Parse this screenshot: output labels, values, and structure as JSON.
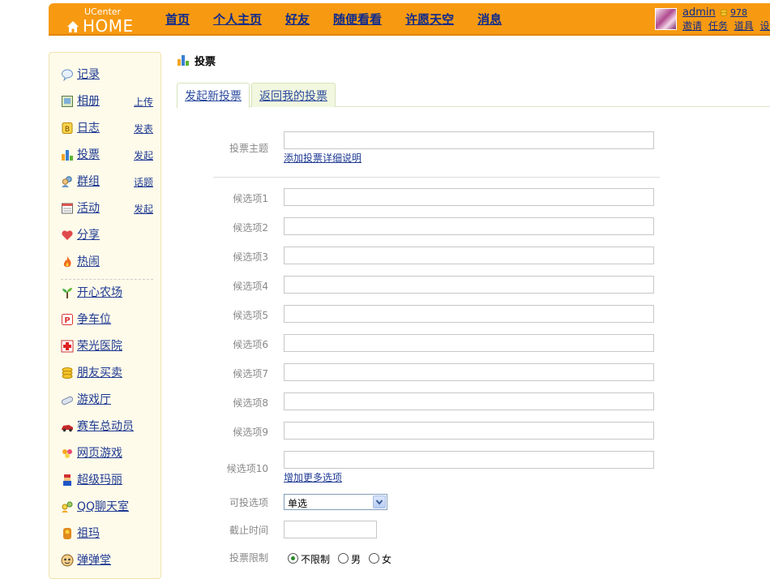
{
  "header": {
    "logo_top": "UCenter",
    "logo_main": "HOME",
    "nav": [
      "首页",
      "个人主页",
      "好友",
      "随便看看",
      "许愿天空",
      "消息"
    ],
    "user": {
      "name": "admin",
      "credit": "978",
      "links": [
        "邀请",
        "任务",
        "道具",
        "设置"
      ]
    }
  },
  "sidebar": {
    "apps": [
      {
        "name": "记录",
        "sub": ""
      },
      {
        "name": "相册",
        "sub": "上传"
      },
      {
        "name": "日志",
        "sub": "发表"
      },
      {
        "name": "投票",
        "sub": "发起"
      },
      {
        "name": "群组",
        "sub": "话题"
      },
      {
        "name": "活动",
        "sub": "发起"
      },
      {
        "name": "分享",
        "sub": ""
      },
      {
        "name": "热闹",
        "sub": ""
      }
    ],
    "games": [
      "开心农场",
      "争车位",
      "荣光医院",
      "朋友买卖",
      "游戏厅",
      "赛车总动员",
      "网页游戏",
      "超级玛丽",
      "QQ聊天室",
      "祖玛",
      "弹弹堂"
    ]
  },
  "main": {
    "title": "投票",
    "tabs": [
      "发起新投票",
      "返回我的投票"
    ],
    "form": {
      "subject_label": "投票主题",
      "add_detail": "添加投票详细说明",
      "options": [
        "候选项1",
        "候选项2",
        "候选项3",
        "候选项4",
        "候选项5",
        "候选项6",
        "候选项7",
        "候选项8",
        "候选项9",
        "候选项10"
      ],
      "add_more": "增加更多选项",
      "vote_type_label": "可投选项",
      "vote_type_value": "单选",
      "deadline_label": "截止时间",
      "limit_label": "投票限制",
      "limit_options": [
        "不限制",
        "男",
        "女"
      ]
    }
  }
}
